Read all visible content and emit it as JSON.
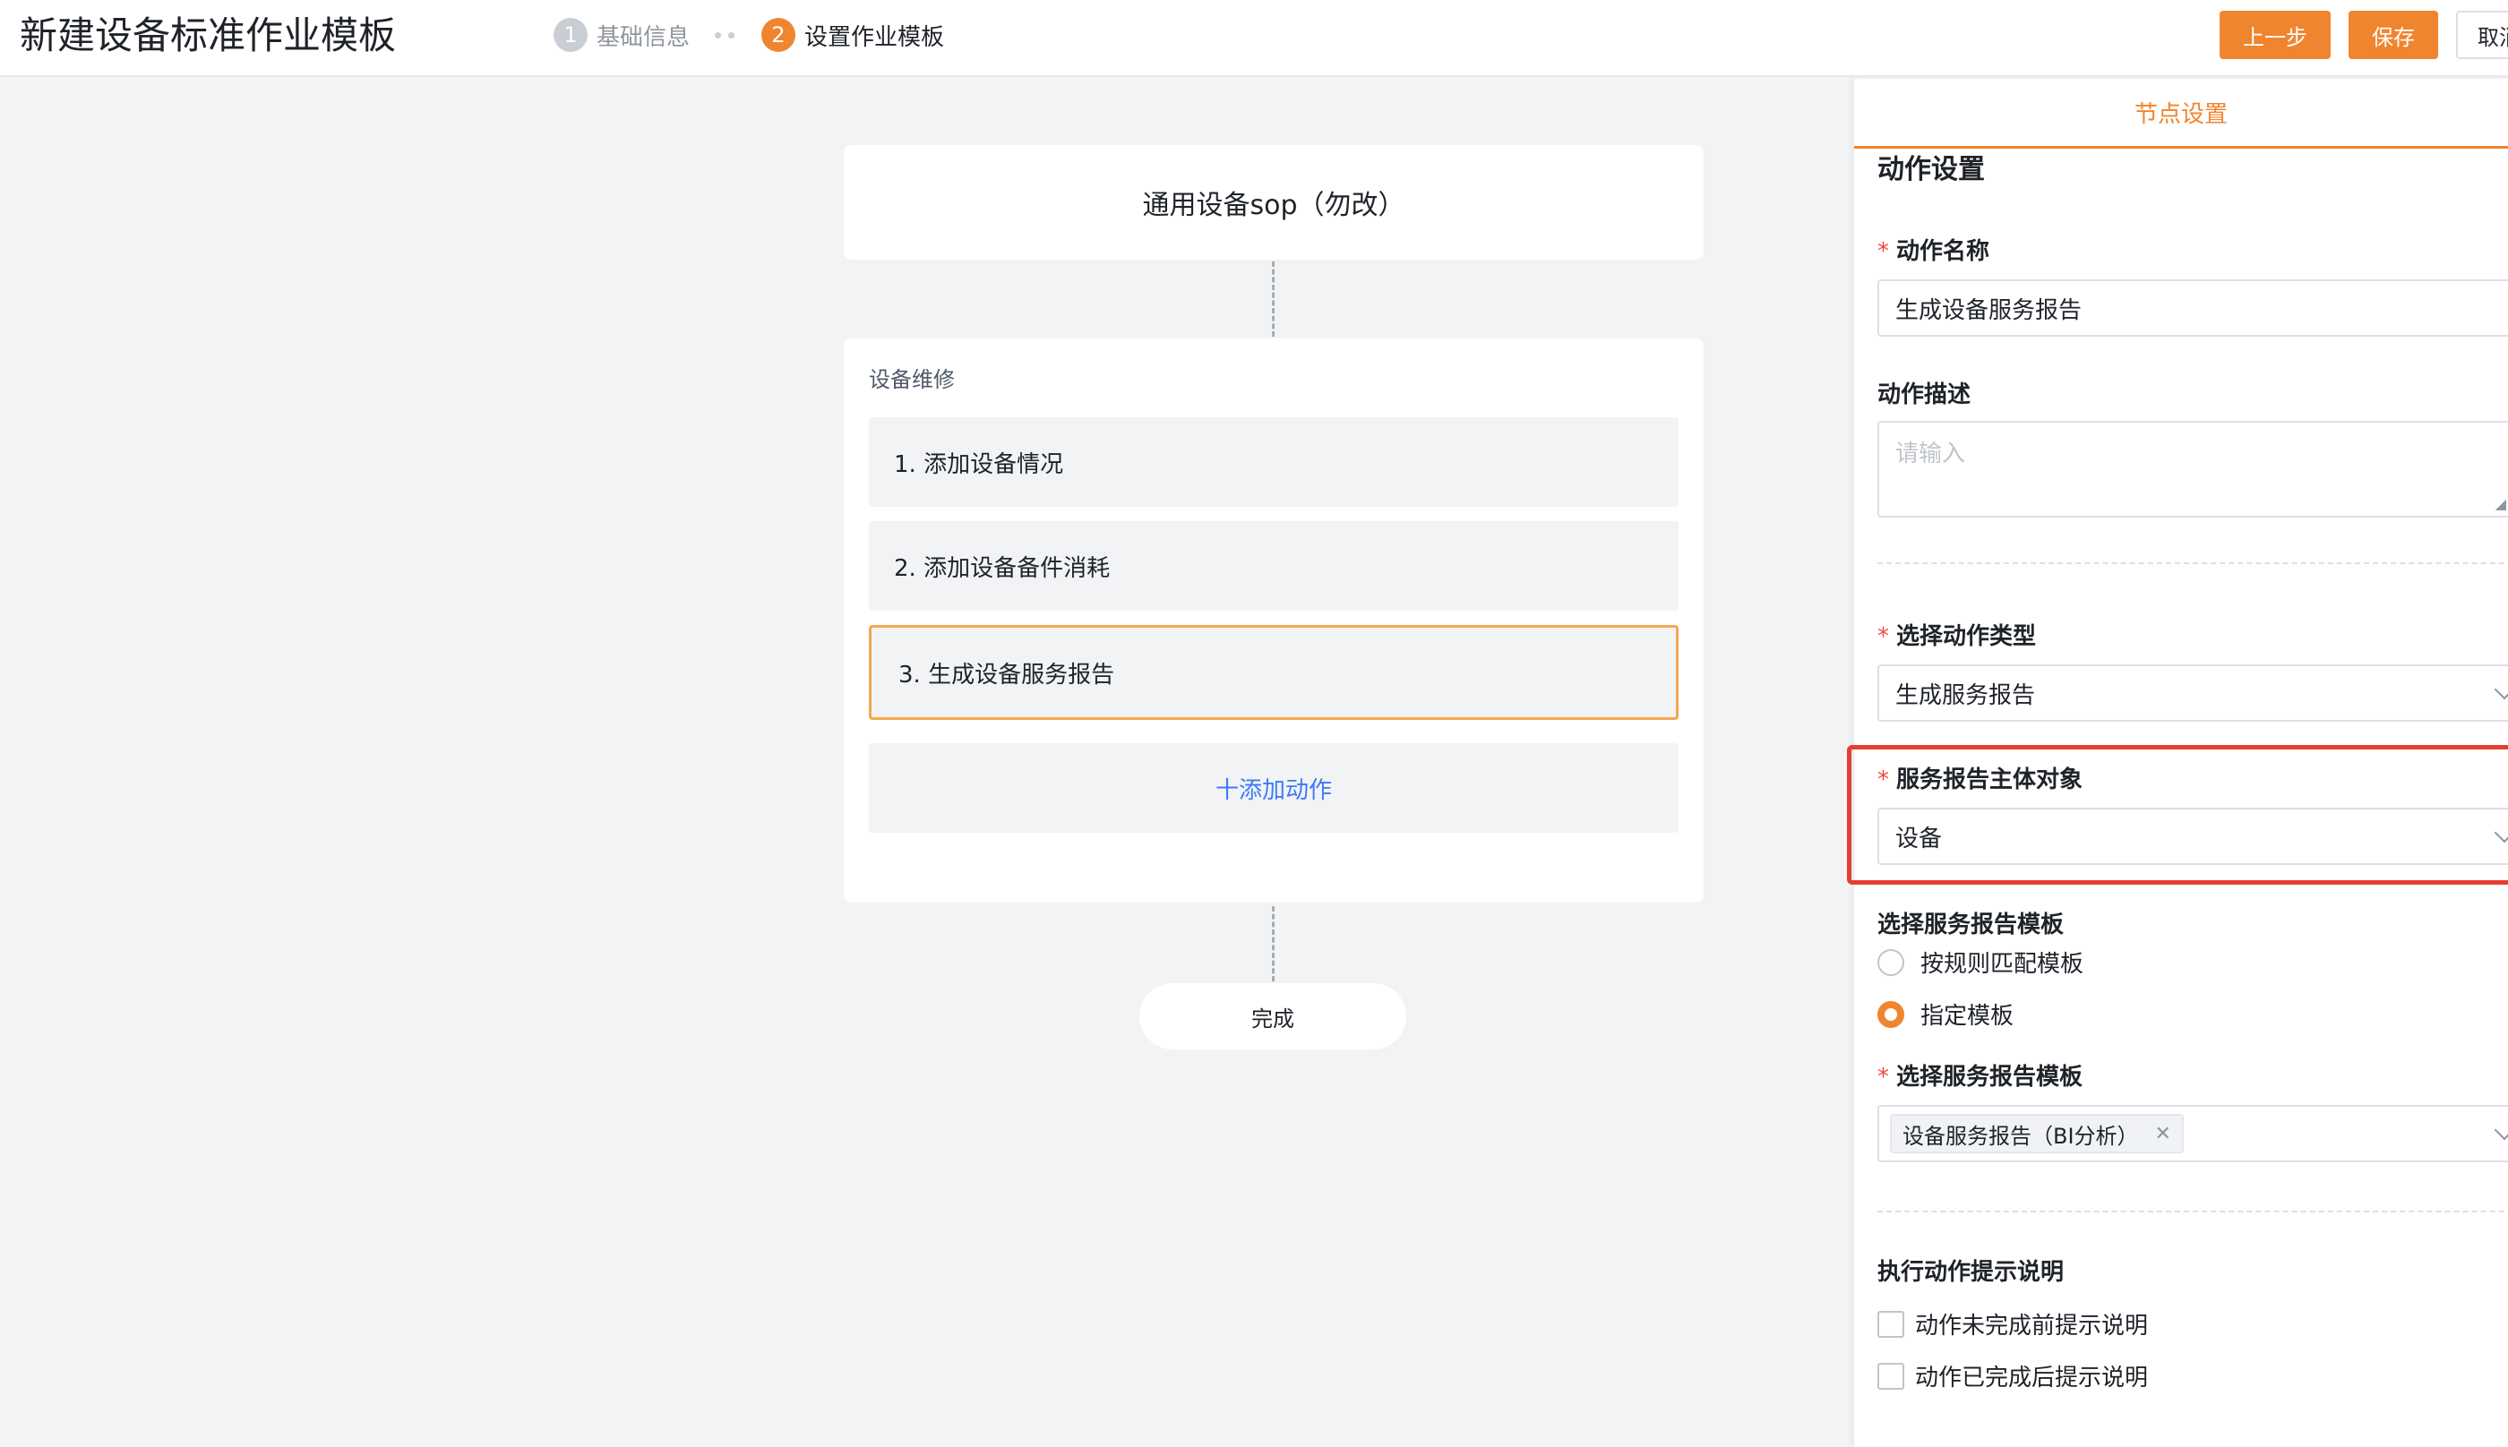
{
  "header": {
    "title": "新建设备标准作业模板",
    "steps": [
      {
        "num": "1",
        "label": "基础信息"
      },
      {
        "num": "2",
        "label": "设置作业模板"
      }
    ],
    "buttons": {
      "prev": "上一步",
      "save": "保存",
      "cancel": "取消"
    }
  },
  "canvas": {
    "start_title": "通用设备sop（勿改）",
    "stage": {
      "name": "设备维修",
      "actions": [
        "1. 添加设备情况",
        "2. 添加设备备件消耗",
        "3. 生成设备服务报告"
      ],
      "add_label": "十添加动作"
    },
    "finish_label": "完成"
  },
  "panel": {
    "tab": "节点设置",
    "section_title": "动作设置",
    "action_name": {
      "label": "动作名称",
      "value": "生成设备服务报告"
    },
    "action_desc": {
      "label": "动作描述",
      "placeholder": "请输入"
    },
    "action_type": {
      "label": "选择动作类型",
      "value": "生成服务报告"
    },
    "report_subject": {
      "label": "服务报告主体对象",
      "value": "设备"
    },
    "template_mode": {
      "label": "选择服务报告模板",
      "options": [
        {
          "label": "按规则匹配模板",
          "checked": false
        },
        {
          "label": "指定模板",
          "checked": true
        }
      ]
    },
    "template_select": {
      "label": "选择服务报告模板",
      "tag": "设备服务报告（BI分析）"
    },
    "hint": {
      "label": "执行动作提示说明",
      "options": [
        "动作未完成前提示说明",
        "动作已完成后提示说明"
      ]
    }
  },
  "colors": {
    "accent": "#f0852f",
    "highlight": "#e53f32",
    "link": "#3c7bf5"
  }
}
